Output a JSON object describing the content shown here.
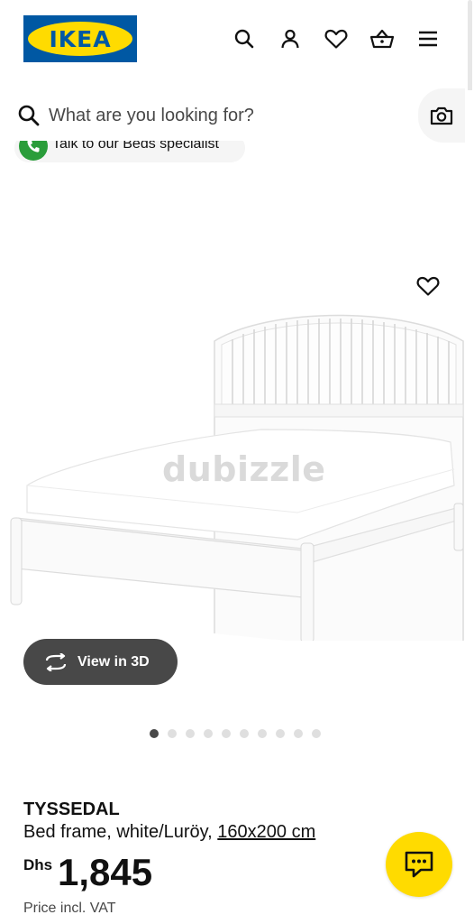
{
  "header": {
    "logo_text": "IKEA",
    "icons": [
      "search-icon",
      "account-icon",
      "heart-icon",
      "cart-icon",
      "menu-icon"
    ]
  },
  "search": {
    "placeholder": "What are you looking for?",
    "camera_icon": "camera-icon"
  },
  "specialist": {
    "label": "Talk to our Beds specialist",
    "icon": "phone-icon",
    "icon_color": "#2a9d3a"
  },
  "media": {
    "watermark": "dubizzle",
    "view3d_label": "View in 3D",
    "dot_count": 10,
    "active_dot": 0
  },
  "product": {
    "name": "TYSSEDAL",
    "description": "Bed frame, white/Luröy, ",
    "size": "160x200 cm",
    "currency": "Dhs",
    "price": "1,845",
    "vat_note": "Price incl. VAT"
  },
  "colors": {
    "brand_blue": "#0058a3",
    "brand_yellow": "#ffdb00",
    "button_dark": "#484848"
  }
}
